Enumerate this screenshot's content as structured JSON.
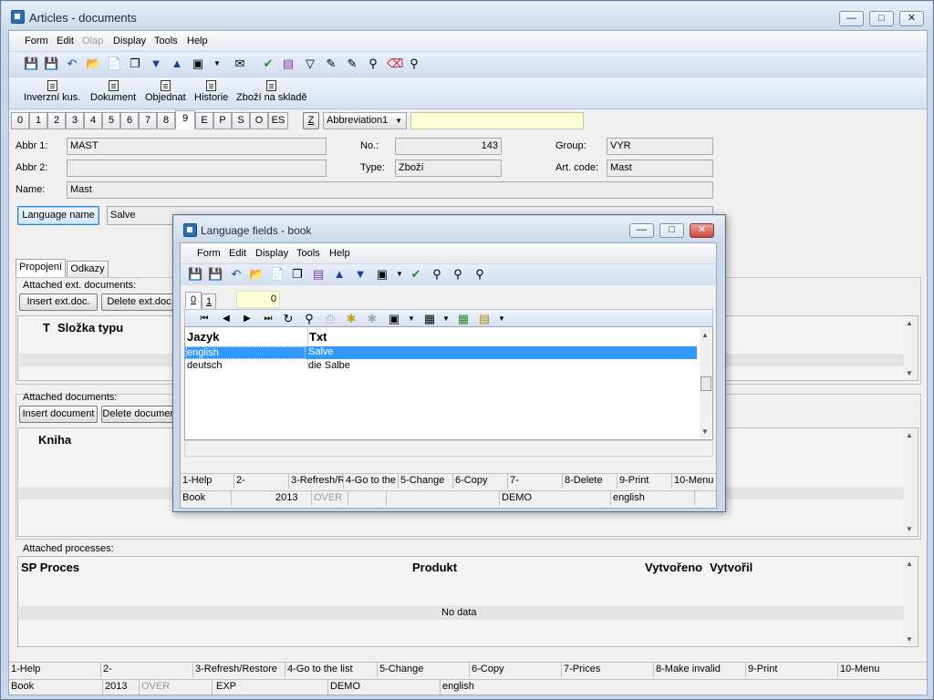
{
  "main_window": {
    "title": "Articles - documents",
    "menu": [
      "Form",
      "Edit",
      "Olap",
      "Display",
      "Tools",
      "Help"
    ],
    "toolbar_icons": [
      "save-icon",
      "save-all-icon",
      "undo-icon",
      "open-folder-icon",
      "new-doc-icon",
      "copy-icon",
      "arrow-down-icon",
      "arrow-up-icon",
      "camera-icon",
      "dropdown-icon",
      "mail-icon",
      "filter-check-icon",
      "book-icon",
      "funnel-icon",
      "edit-icon",
      "binoculars-icon",
      "delete-doc-icon",
      "binoculars-filter-icon"
    ],
    "big_buttons": [
      "Inverzní kus.",
      "Dokument",
      "Objednat",
      "Historie",
      "Zboží na skladě"
    ],
    "tabs": [
      "0",
      "1",
      "2",
      "3",
      "4",
      "5",
      "6",
      "7",
      "8",
      "9",
      "E",
      "P",
      "S",
      "O",
      "ES"
    ],
    "active_tab": "9",
    "z_button": "Z",
    "abbreviation_select": "Abbreviation1",
    "abbreviation_input": "",
    "fields": {
      "abbr1_label": "Abbr 1:",
      "abbr1": "MAST",
      "abbr2_label": "Abbr 2:",
      "abbr2": "",
      "name_label": "Name:",
      "name": "Mast",
      "no_label": "No.:",
      "no": "143",
      "type_label": "Type:",
      "type": "Zboží",
      "group_label": "Group:",
      "group": "VYR",
      "artcode_label": "Art. code:",
      "artcode": "Mast"
    },
    "language_name_button": "Language name",
    "language_name_value": "Salve",
    "subtabs": [
      "Propojení",
      "Odkazy"
    ],
    "ext_docs": {
      "label": "Attached ext. documents:",
      "insert": "Insert ext.doc.",
      "delete": "Delete ext.doc.",
      "col_t": "T",
      "col_folder": "Složka typu"
    },
    "docs": {
      "label": "Attached documents:",
      "insert": "Insert document",
      "delete": "Delete document",
      "col_book": "Kniha"
    },
    "processes": {
      "label": "Attached processes:",
      "col_sp": "SP Proces",
      "col_product": "Produkt",
      "col_created": "Vytvořeno",
      "col_creator": "Vytvořil",
      "empty": "No data"
    },
    "fkeys": [
      "1-Help",
      "2-",
      "3-Refresh/Restore",
      "4-Go to the list",
      "5-Change",
      "6-Copy",
      "7-Prices",
      "8-Make invalid",
      "9-Print",
      "10-Menu"
    ],
    "status": [
      "Book",
      "2013",
      "OVER",
      "EXP",
      "DEMO",
      "english"
    ]
  },
  "dialog": {
    "title": "Language fields - book",
    "menu": [
      "Form",
      "Edit",
      "Display",
      "Tools",
      "Help"
    ],
    "tabs": [
      "0",
      "1"
    ],
    "active_tab": "0",
    "counter": "0",
    "columns": [
      "Jazyk",
      "Txt"
    ],
    "rows": [
      {
        "lang": "english",
        "txt": "Salve",
        "selected": true
      },
      {
        "lang": "deutsch",
        "txt": "die Salbe",
        "selected": false
      }
    ],
    "fkeys": [
      "1-Help",
      "2-",
      "3-Refresh/R",
      "4-Go to the",
      "5-Change",
      "6-Copy",
      "7-",
      "8-Delete",
      "9-Print",
      "10-Menu"
    ],
    "status": [
      "Book",
      "2013",
      "OVER",
      "DEMO",
      "english"
    ]
  }
}
